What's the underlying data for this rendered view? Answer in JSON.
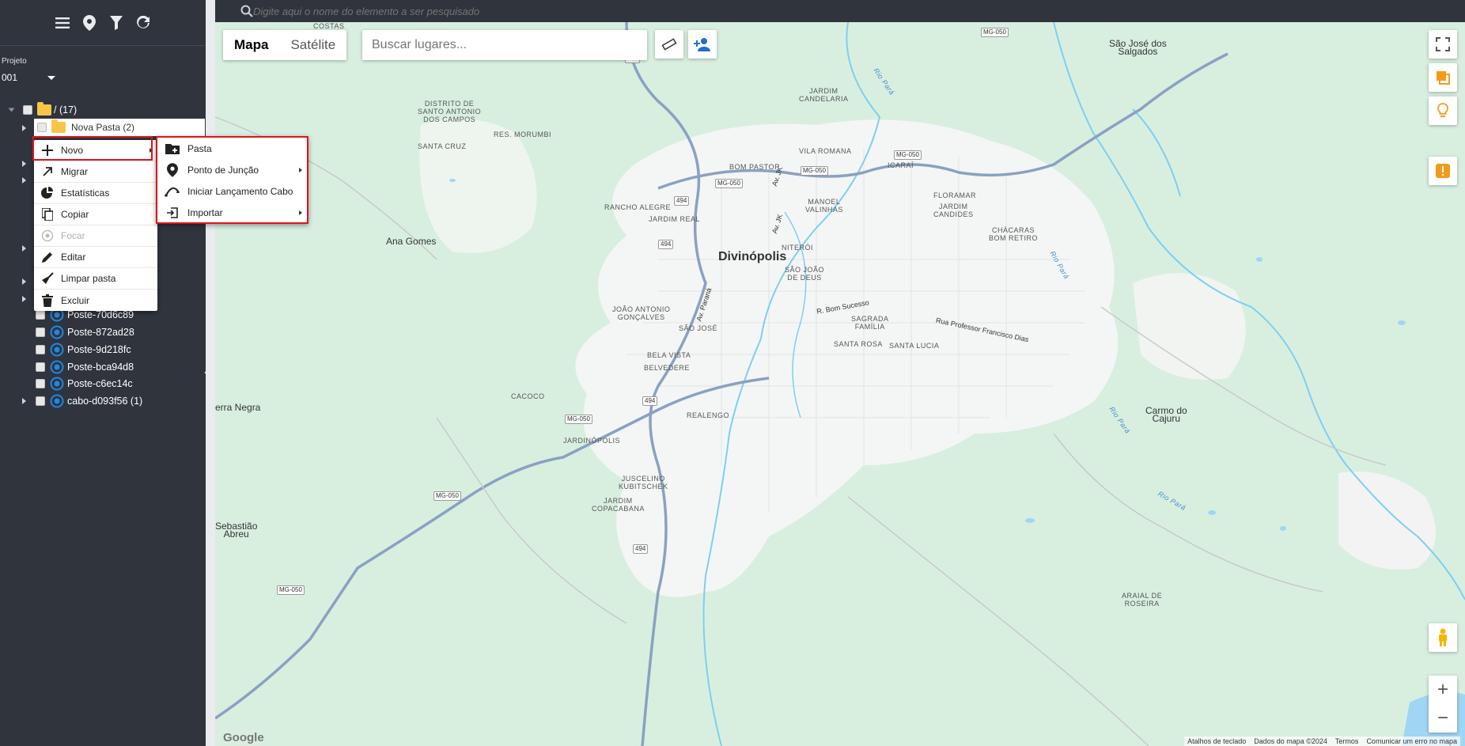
{
  "sidebar": {
    "project_label": "Projeto",
    "project_value": "001",
    "tree": {
      "root": "/ (17)",
      "nova_pasta": "Nova Pasta (2)",
      "items": [
        "Poste-70d6c89",
        "Poste-872ad28",
        "Poste-9d218fc",
        "Poste-bca94d8",
        "Poste-c6ec14c",
        "cabo-d093f56 (1)"
      ]
    },
    "collapse_glyph": "«"
  },
  "search": {
    "placeholder": "Digite aqui o nome do elemento a ser pesquisado"
  },
  "context_menu": {
    "items": [
      "Novo",
      "Migrar",
      "Estatísticas",
      "Copiar",
      "Focar",
      "Editar",
      "Limpar pasta",
      "Excluir"
    ]
  },
  "submenu": {
    "items": [
      "Pasta",
      "Ponto de Junção",
      "Iniciar Lançamento Cabo",
      "Importar"
    ]
  },
  "map": {
    "type_map": "Mapa",
    "type_satellite": "Satélite",
    "places_placeholder": "Buscar lugares...",
    "google": "Google",
    "footer": [
      "Atalhos de teclado",
      "Dados do mapa ©2024",
      "Termos",
      "Comunicar um erro no mapa"
    ],
    "labels": {
      "divinopolis": "Divinópolis",
      "ana_gomes": "Ana Gomes",
      "serra_negra": "erra Negra",
      "sebastiao": "Sebastião\nAbreu",
      "sao_jose": "São José dos\nSalgados",
      "carmo": "Carmo do\nCajuru",
      "costas": "Costas",
      "santo_antonio": "DISTRITO DE\nSANTO ANTONIO\nDOS CAMPOS",
      "santa_cruz": "SANTA CRUZ",
      "morumbi": "RES. MORUMBI",
      "candelaria": "JARDIM\nCANDELARIA",
      "vila_romana": "VILA ROMANA",
      "bom_pastor": "BOM PASTOR",
      "icarai": "ICARAÍ",
      "rancho": "RANCHO ALEGRE",
      "jardim_real": "JARDIM REAL",
      "manoel": "MANOEL\nVALINHAS",
      "floramar": "FLORAMAR",
      "candides": "JARDIM\nCANDIDES",
      "chacaras": "CHÁCARAS\nBOM RETIRO",
      "niteroi": "NITERÓI",
      "sao_joao": "SÃO JOÃO\nDE DEUS",
      "joao_antonio": "JOÃO ANTONIO\nGONÇALVES",
      "sao_jose_b": "SÃO JOSÉ",
      "bela_vista": "BELA VISTA",
      "belvedere": "BELVEDERE",
      "sagrada": "SAGRADA\nFAMÍLIA",
      "santa_rosa": "SANTA ROSA",
      "santa_lucia": "SANTA LUCIA",
      "cacoco": "CACOCO",
      "realengo": "REALENGO",
      "jardinopolis": "JARDINÓPOLIS",
      "juscelino": "JUSCELINO\nKUBITSCHEK",
      "copacabana": "JARDIM\nCOPACABANA",
      "arraial": "ARAIAL DE\nROSEIRA",
      "bom_sucesso": "R. Bom Sucesso",
      "francisco": "Rua Professor Francisco Dias",
      "av_parana": "Av. Paraná",
      "av_jk": "Av. JK",
      "av_jk2": "Av. JK",
      "rio_para1": "Rio Pará",
      "rio_para2": "Rio Pará",
      "rio_para3": "Rio Pará",
      "rio_para4": "Rio Pará"
    },
    "shields": [
      "494",
      "494",
      "494",
      "494",
      "494",
      "MG-050",
      "MG-050",
      "MG-050",
      "MG-050",
      "MG-050",
      "MG-050",
      "MG-050"
    ]
  },
  "colors": {
    "accent_red": "#e0141c",
    "sidebar_bg": "#2f343d",
    "map_green": "#d8efe0",
    "pole_blue": "#1e88e5",
    "folder_yellow": "#f7c646"
  }
}
